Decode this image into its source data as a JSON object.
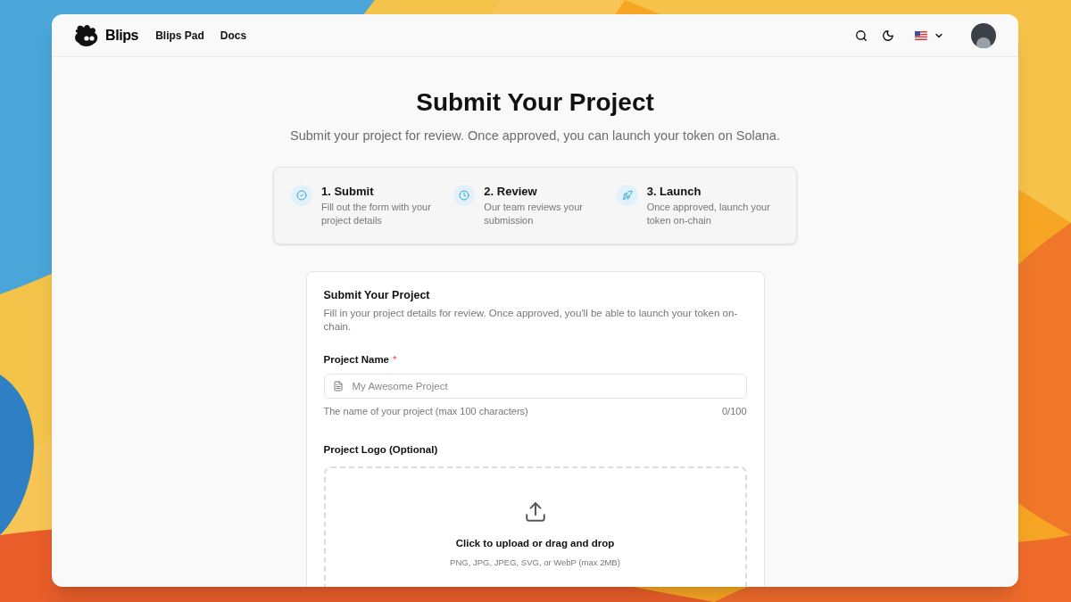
{
  "nav": {
    "brand": "Blips",
    "links": [
      {
        "label": "Blips Pad"
      },
      {
        "label": "Docs"
      }
    ]
  },
  "hero": {
    "title": "Submit Your Project",
    "subtitle": "Submit your project for review. Once approved, you can launch your token on Solana."
  },
  "steps": [
    {
      "kind": "check",
      "title": "1. Submit",
      "text": "Fill out the form with your project details"
    },
    {
      "kind": "clock",
      "title": "2. Review",
      "text": "Our team reviews your submission"
    },
    {
      "kind": "rocket",
      "title": "3. Launch",
      "text": "Once approved, launch your token on-chain"
    }
  ],
  "form": {
    "title": "Submit Your Project",
    "description": "Fill in your project details for review. Once approved, you'll be able to launch your token on-chain.",
    "name_field": {
      "label": "Project Name",
      "required_mark": "*",
      "placeholder": "My Awesome Project",
      "hint": "The name of your project (max 100 characters)",
      "counter": "0/100"
    },
    "logo_field": {
      "label": "Project Logo (Optional)",
      "prompt": "Click to upload or drag and drop",
      "formats": "PNG, JPG, JPEG, SVG, or WebP (max 2MB)"
    }
  }
}
